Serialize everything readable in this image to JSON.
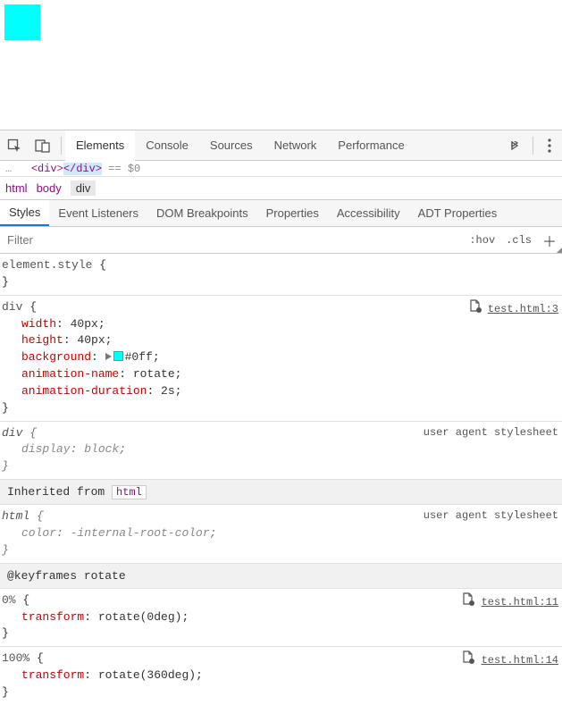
{
  "preview": {
    "box_color": "#0ff"
  },
  "toolbar": {
    "tabs": [
      "Elements",
      "Console",
      "Sources",
      "Network",
      "Performance"
    ],
    "active_index": 0
  },
  "source_line": {
    "prefix": "…",
    "open_tag": "<div>",
    "close_tag": "</div>",
    "suffix": " == $0"
  },
  "breadcrumb": {
    "items": [
      "html",
      "body",
      "div"
    ],
    "current_index": 2
  },
  "subtabs": [
    "Styles",
    "Event Listeners",
    "DOM Breakpoints",
    "Properties",
    "Accessibility",
    "ADT Properties"
  ],
  "subtab_active_index": 0,
  "filter": {
    "placeholder": "Filter",
    "hov": ":hov",
    "cls": ".cls"
  },
  "rules": {
    "element_style": "element.style",
    "div_rule": {
      "selector": "div",
      "source": "test.html:3",
      "props": [
        {
          "name": "width",
          "value": "40px"
        },
        {
          "name": "height",
          "value": "40px"
        },
        {
          "name": "background",
          "value": "#0ff",
          "swatch": true,
          "play": true
        },
        {
          "name": "animation-name",
          "value": "rotate"
        },
        {
          "name": "animation-duration",
          "value": "2s"
        }
      ]
    },
    "ua_div": {
      "selector": "div",
      "label": "user agent stylesheet",
      "props": [
        {
          "name": "display",
          "value": "block"
        }
      ]
    },
    "inherited_label": "Inherited from",
    "inherited_chip": "html",
    "ua_html": {
      "selector": "html",
      "label": "user agent stylesheet",
      "props": [
        {
          "name": "color",
          "value": "-internal-root-color"
        }
      ]
    },
    "keyframes_label": "@keyframes rotate",
    "kf0": {
      "selector": "0%",
      "source": "test.html:11",
      "props": [
        {
          "name": "transform",
          "value": "rotate(0deg)"
        }
      ]
    },
    "kf100": {
      "selector": "100%",
      "source": "test.html:14",
      "props": [
        {
          "name": "transform",
          "value": "rotate(360deg)"
        }
      ]
    }
  }
}
